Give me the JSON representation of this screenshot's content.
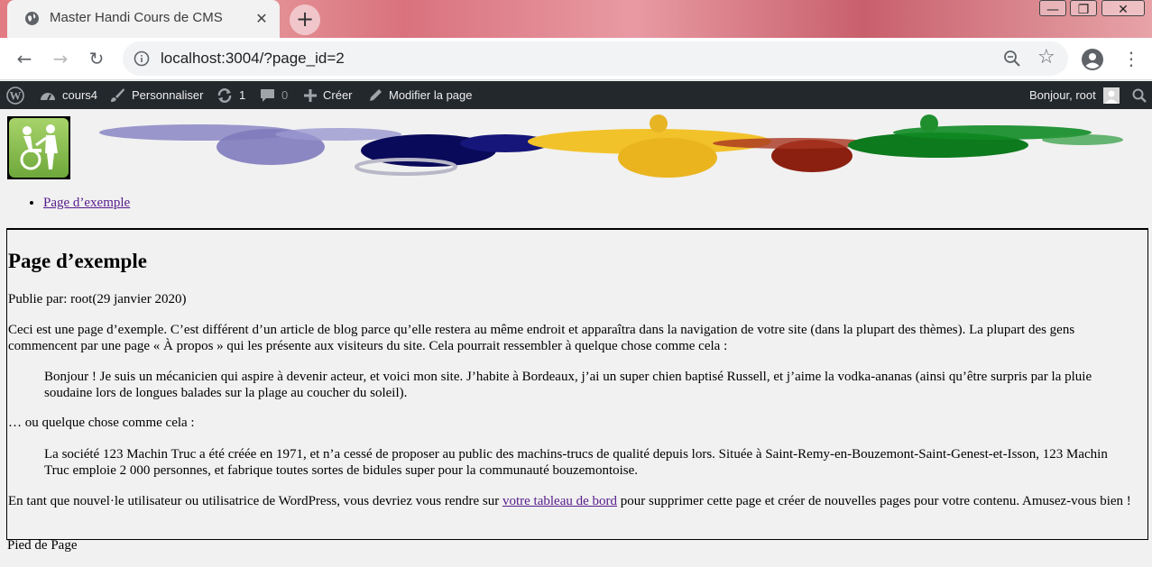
{
  "browser": {
    "tab_title": "Master Handi Cours de CMS",
    "url": "localhost:3004/?page_id=2"
  },
  "adminbar": {
    "site_name": "cours4",
    "customize": "Personnaliser",
    "updates_count": "1",
    "comments_count": "0",
    "new": "Créer",
    "edit_page": "Modifier la page",
    "greeting": "Bonjour, root"
  },
  "site": {
    "menu_items": [
      "Page d’exemple"
    ]
  },
  "article": {
    "title": "Page d’exemple",
    "meta": "Publie par: root(29 janvier 2020)",
    "p1": "Ceci est une page d’exemple. C’est différent d’un article de blog parce qu’elle restera au même endroit et apparaîtra dans la navigation de votre site (dans la plupart des thèmes). La plupart des gens commencent par une page « À propos » qui les présente aux visiteurs du site. Cela pourrait ressembler à quelque chose comme cela :",
    "quote1": "Bonjour ! Je suis un mécanicien qui aspire à devenir acteur, et voici mon site. J’habite à Bordeaux, j’ai un super chien baptisé Russell, et j’aime la vodka-ananas (ainsi qu’être surpris par la pluie soudaine lors de longues balades sur la plage au coucher du soleil).",
    "p2": "… ou quelque chose comme cela :",
    "quote2": "La société 123 Machin Truc a été créée en 1971, et n’a cessé de proposer au public des machins-trucs de qualité depuis lors. Située à Saint-Remy-en-Bouzemont-Saint-Genest-et-Isson, 123 Machin Truc emploie 2 000 personnes, et fabrique toutes sortes de bidules super pour la communauté bouzemontoise.",
    "p3_before": "En tant que nouvel·le utilisateur ou utilisatrice de WordPress, vous devriez vous rendre sur ",
    "p3_link": "votre tableau de bord",
    "p3_after": " pour supprimer cette page et créer de nouvelles pages pour votre contenu. Amusez-vous bien !"
  },
  "footer": {
    "text": "Pied de Page"
  },
  "colors": {
    "adminbar_bg": "#23282d",
    "link_visited": "#551a8b",
    "page_bg": "#f1f1f1"
  },
  "icons": [
    "globe-icon",
    "close-icon",
    "plus-icon",
    "back-icon",
    "forward-icon",
    "reload-icon",
    "info-icon",
    "zoom-icon",
    "star-icon",
    "account-icon",
    "menu-kebab-icon",
    "wordpress-icon",
    "dashboard-icon",
    "brush-icon",
    "updates-icon",
    "comment-icon",
    "edit-icon",
    "avatar",
    "search-icon",
    "accessibility-logo"
  ]
}
